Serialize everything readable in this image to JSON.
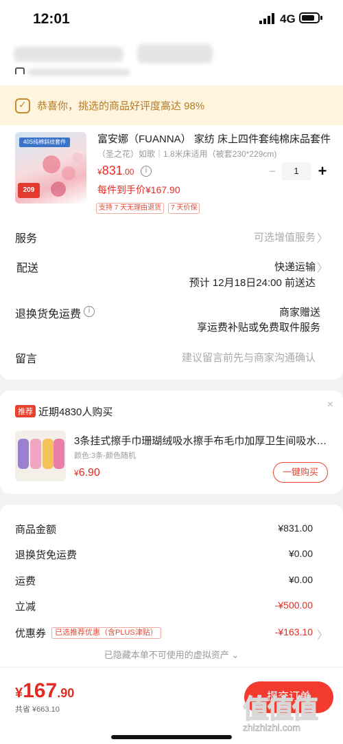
{
  "status_bar": {
    "time": "12:01",
    "network": "4G"
  },
  "banner": {
    "text": "恭喜你，挑选的商品好评度高达 98%"
  },
  "product": {
    "title": "富安娜（FUANNA） 家纺 床上四件套纯棉床品套件",
    "spec": "（圣之花）如歌｜1.8米床适用（被套230*229cm)",
    "price_currency": "¥",
    "price_int": "831",
    "price_dec": ".00",
    "final_price": "每件到手价¥167.90",
    "quantity": "1",
    "minus": "−",
    "plus": "+",
    "badges": [
      "支持 7 天无理由退货",
      "7 天价保"
    ],
    "thumb_tag": "40S纯棉斜纹套件",
    "thumb_price": "209"
  },
  "rows": {
    "service_label": "服务",
    "service_value": "可选增值服务",
    "delivery_label": "配送",
    "delivery_value": "快递运输",
    "delivery_eta": "预计 12月18日24:00 前送达",
    "return_label": "退换货免运费",
    "return_value": "商家赠送",
    "return_desc": "享运费补贴或免费取件服务",
    "note_label": "留言",
    "note_placeholder": "建议留言前先与商家沟通确认"
  },
  "recommend": {
    "tag": "推荐",
    "recent_buyers": "近期4830人购买",
    "title": "3条挂式擦手巾珊瑚绒吸水擦手布毛巾加厚卫生间吸水擦手巾",
    "spec": "颜色:3条-颜色随机",
    "price_currency": "¥",
    "price_int": "6.90",
    "buy_label": "一键购买",
    "close": "×"
  },
  "summary": {
    "goods_label": "商品金额",
    "goods_value": "¥831.00",
    "return_label": "退换货免运费",
    "return_value": "¥0.00",
    "shipping_label": "运费",
    "shipping_value": "¥0.00",
    "discount_label": "立减",
    "discount_value": "-¥500.00",
    "coupon_label": "优惠券",
    "coupon_tag": "已选推荐优惠（含PLUS津贴）",
    "coupon_value": "-¥163.10",
    "hidden_note": "已隐藏本单不可使用的虚拟资产 ⌄"
  },
  "bottom": {
    "currency": "¥",
    "total_int": "167",
    "total_dec": ".90",
    "saved": "共省 ¥663.10",
    "submit": "提交订单"
  },
  "watermark": {
    "logo": "值值值",
    "url": "zhizhizhi.com"
  },
  "icons": {
    "chevron": "〉",
    "info": "i"
  },
  "colors": {
    "accent": "#e32b22",
    "banner_bg": "#fff5df",
    "banner_text": "#b57a22"
  }
}
